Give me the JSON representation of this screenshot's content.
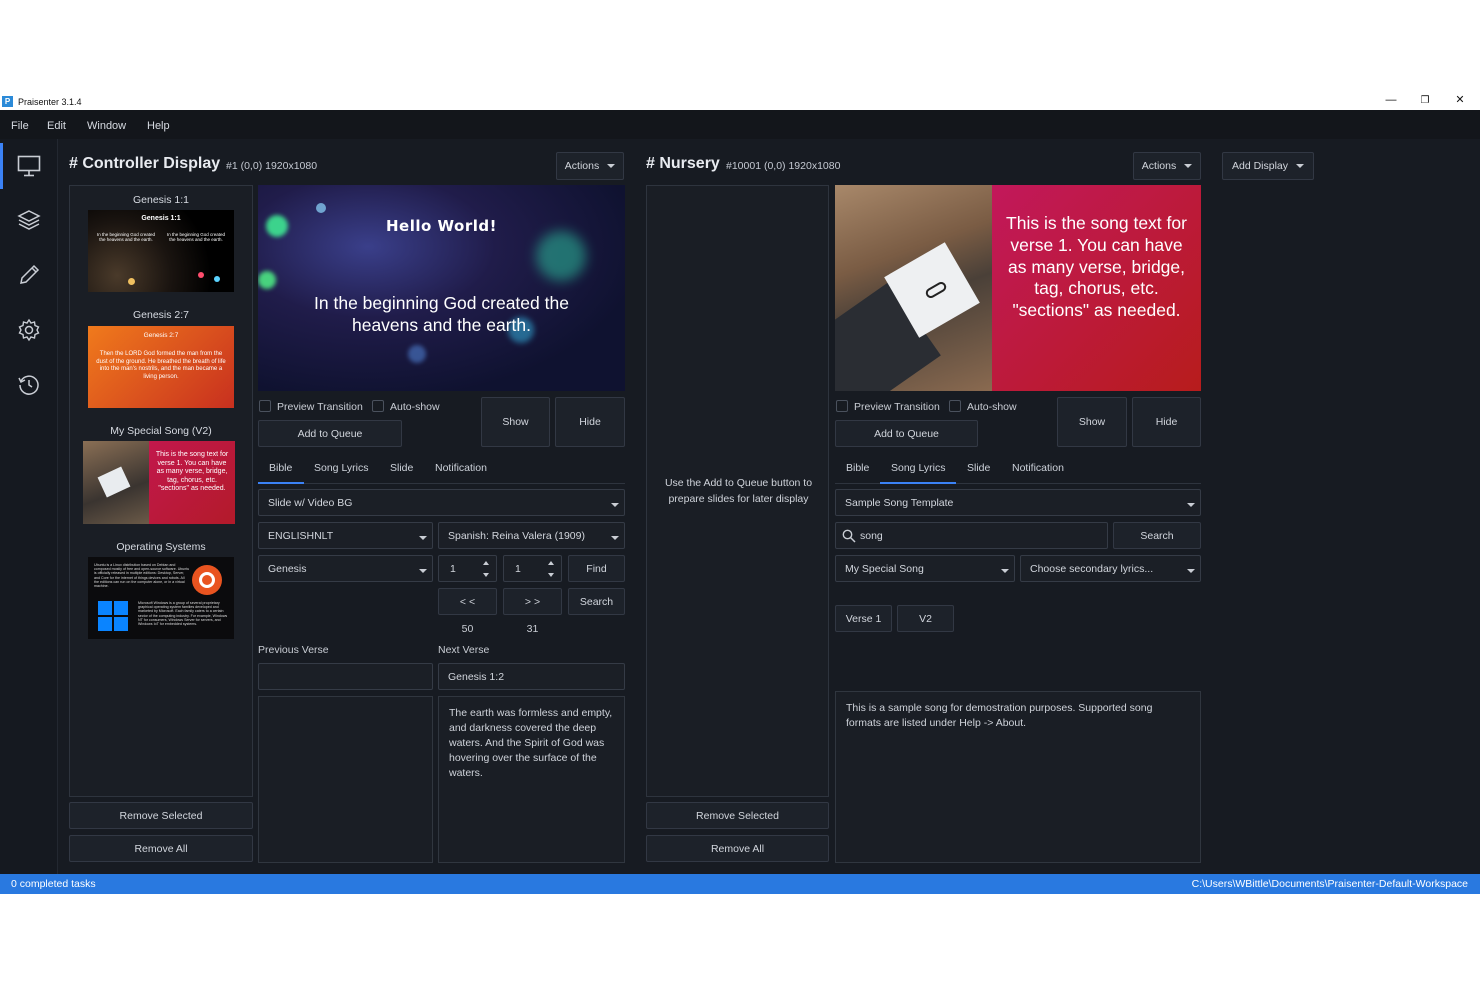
{
  "window": {
    "title": "Praisenter 3.1.4",
    "app_icon_letter": "P",
    "controls": [
      "—",
      "❐",
      "✕"
    ]
  },
  "menu": [
    "File",
    "Edit",
    "Window",
    "Help"
  ],
  "rail_icons": [
    "monitor-icon",
    "layers-icon",
    "pencil-icon",
    "gear-icon",
    "history-icon"
  ],
  "controller": {
    "title": "# Controller Display",
    "subtitle": "#1 (0,0) 1920x1080",
    "actions": "Actions",
    "queue": [
      {
        "title": "Genesis 1:1",
        "heading": "Genesis 1:1",
        "left": "In the beginning God created the heavens and the earth.",
        "right": "In the beginning God created the heavens and the earth."
      },
      {
        "title": "Genesis 2:7",
        "heading": "Genesis 2:7",
        "text": "Then the LORD God formed the man from the dust of the ground. He breathed the breath of life into the man's nostrils, and the man became a living person."
      },
      {
        "title": "My Special Song (V2)",
        "text": "This is the song text for verse 1. You can have as many verse, bridge, tag, chorus, etc. \"sections\" as needed."
      },
      {
        "title": "Operating Systems",
        "text1": "Ubuntu is a Linux distribution based on Debian and composed mostly of free and open-source software. Ubuntu is officially released in multiple editions: Desktop, Server, and Core for the internet of things devices and robots. All the editions can run on the computer alone, or in a virtual machine.",
        "text2": "Microsoft Windows is a group of several proprietary graphical operating system families developed and marketed by Microsoft. Each family caters to a certain sector of the computing industry. For example, Windows NT for consumers, Windows Server for servers, and Windows IoT for embedded systems."
      }
    ],
    "remove_selected": "Remove Selected",
    "remove_all": "Remove All",
    "preview": {
      "heading": "Hello World!",
      "text": "In the beginning God created the heavens and the earth."
    },
    "preview_transition": "Preview Transition",
    "auto_show": "Auto-show",
    "add_to_queue": "Add to Queue",
    "show": "Show",
    "hide": "Hide",
    "tabs": [
      "Bible",
      "Song Lyrics",
      "Slide",
      "Notification"
    ],
    "active_tab": "Bible",
    "template": "Slide w/ Video BG",
    "bible_primary": "ENGLISHNLT",
    "bible_secondary": "Spanish: Reina Valera (1909)",
    "book": "Genesis",
    "chapter": "1",
    "verse": "1",
    "find": "Find",
    "prev": "< <",
    "next": "> >",
    "search": "Search",
    "chapter_count": "50",
    "verse_count": "31",
    "previous_verse_label": "Previous Verse",
    "next_verse_label": "Next Verse",
    "previous_verse_ref": "",
    "next_verse_ref": "Genesis 1:2",
    "previous_verse_text": "",
    "next_verse_text": "The earth was formless and empty, and darkness covered the deep waters. And the Spirit of God was hovering over the surface of the waters."
  },
  "nursery": {
    "title": "# Nursery",
    "subtitle": "#10001 (0,0) 1920x1080",
    "actions": "Actions",
    "add_display": "Add Display",
    "empty_queue": "Use the Add to Queue button to prepare slides for later display",
    "remove_selected": "Remove Selected",
    "remove_all": "Remove All",
    "preview_text": "This is the song text for verse 1.  You can have as many verse, bridge, tag, chorus, etc. \"sections\" as needed.",
    "preview_transition": "Preview Transition",
    "auto_show": "Auto-show",
    "add_to_queue": "Add to Queue",
    "show": "Show",
    "hide": "Hide",
    "tabs": [
      "Bible",
      "Song Lyrics",
      "Slide",
      "Notification"
    ],
    "active_tab": "Song Lyrics",
    "template": "Sample Song Template",
    "search_value": "song",
    "search": "Search",
    "song": "My Special Song",
    "secondary_placeholder": "Choose secondary lyrics...",
    "sections": [
      "Verse 1",
      "V2"
    ],
    "song_notes": "This is a sample song for demostration purposes.  Supported song formats are listed under Help -> About."
  },
  "status": {
    "left": "0 completed tasks",
    "right": "C:\\Users\\WBittle\\Documents\\Praisenter-Default-Workspace"
  },
  "colors": {
    "accent": "#3b82f6",
    "status_bar": "#2979e0",
    "background": "#171b22"
  }
}
